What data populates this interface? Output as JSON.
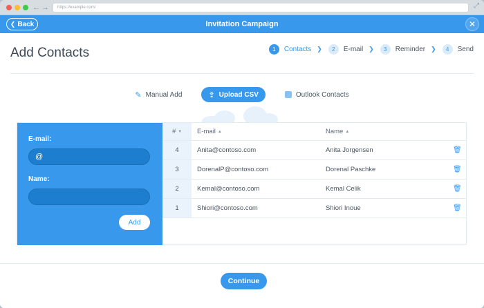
{
  "browser": {
    "url": "https://example.com/"
  },
  "topbar": {
    "back_label": "Back",
    "title": "Invitation Campaign"
  },
  "page": {
    "title": "Add Contacts"
  },
  "steps": [
    {
      "num": "1",
      "label": "Contacts",
      "active": true
    },
    {
      "num": "2",
      "label": "E-mail",
      "active": false
    },
    {
      "num": "3",
      "label": "Reminder",
      "active": false
    },
    {
      "num": "4",
      "label": "Send",
      "active": false
    }
  ],
  "tabs": {
    "manual": "Manual Add",
    "upload": "Upload CSV",
    "outlook": "Outlook Contacts"
  },
  "form": {
    "email_label": "E-mail:",
    "email_value": "@",
    "name_label": "Name:",
    "name_value": "",
    "add_label": "Add"
  },
  "table": {
    "headers": {
      "num": "#",
      "email": "E-mail",
      "name": "Name"
    },
    "rows": [
      {
        "num": "4",
        "email": "Anita@contoso.com",
        "name": "Anita Jorgensen"
      },
      {
        "num": "3",
        "email": "DorenalP@contoso.com",
        "name": "Dorenal Paschke"
      },
      {
        "num": "2",
        "email": "Kemal@contoso.com",
        "name": "Kemal Celik"
      },
      {
        "num": "1",
        "email": "Shiori@contoso.com",
        "name": "Shiori Inoue"
      }
    ]
  },
  "footer": {
    "continue_label": "Continue"
  },
  "colors": {
    "accent": "#3899ec",
    "accent_dark": "#1d7ecf",
    "light_accent": "#eaf3fc"
  },
  "icons": {
    "back": "chevron-left-icon",
    "close": "close-icon",
    "manual": "pencil-icon",
    "upload": "upload-icon",
    "outlook": "outlook-icon",
    "trash": "trash-icon",
    "sort": "sort-arrow-icon"
  }
}
